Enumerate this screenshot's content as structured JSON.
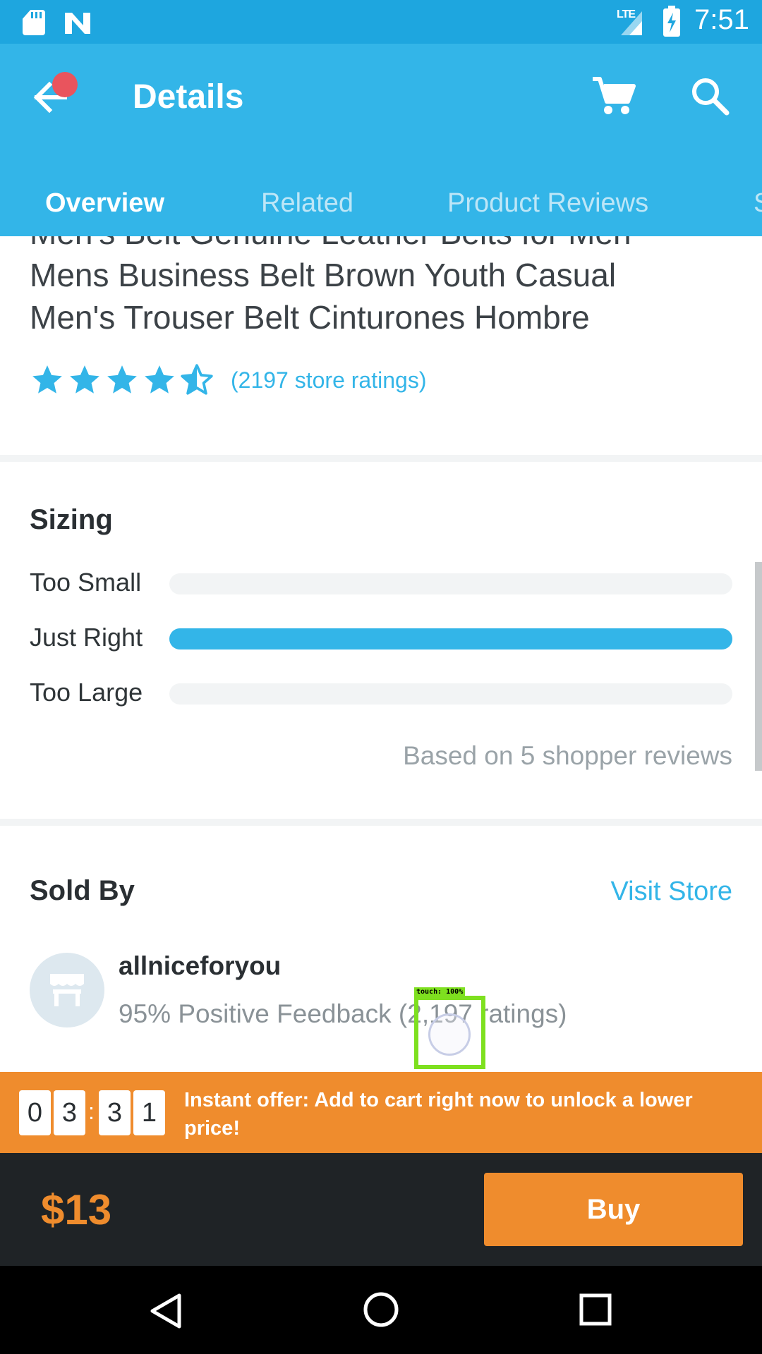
{
  "status_bar": {
    "network_label": "LTE",
    "time": "7:51",
    "icons": [
      "sd-card-icon",
      "n-icon",
      "signal-icon",
      "battery-charging-icon"
    ]
  },
  "header": {
    "title": "Details",
    "icons": [
      "back-arrow-icon",
      "cart-icon",
      "search-icon"
    ],
    "notification_dot_color": "#e9545d",
    "background_color": "#33b5e8"
  },
  "tabs": [
    {
      "label": "Overview",
      "active": true
    },
    {
      "label": "Related",
      "active": false
    },
    {
      "label": "Product Reviews",
      "active": false
    },
    {
      "label": "S",
      "active": false
    }
  ],
  "product": {
    "title": "Men's Belt Genuine Leather Belts for Men Mens Business Belt Brown Youth Casual Men's Trouser Belt Cinturones Hombre",
    "rating_stars": 4.5,
    "store_ratings": "(2197 store ratings)"
  },
  "sizing": {
    "title": "Sizing",
    "rows": [
      {
        "label": "Too Small",
        "fraction": 0
      },
      {
        "label": "Just Right",
        "fraction": 1
      },
      {
        "label": "Too Large",
        "fraction": 0
      }
    ],
    "based_on": "Based on 5 shopper reviews"
  },
  "sold_by": {
    "title": "Sold By",
    "visit_store": "Visit Store",
    "seller_name": "allniceforyou",
    "feedback": "95% Positive Feedback (2,197 ratings)",
    "avatar_icon": "store-icon"
  },
  "touch_overlay": {
    "label": "touch: 100%"
  },
  "offer": {
    "timer_digits": [
      "0",
      "3",
      "3",
      "1"
    ],
    "separator": ":",
    "text": "Instant offer: Add to cart right now to unlock a lower price!",
    "color": "#ef8c2d"
  },
  "buy_bar": {
    "price": "$13",
    "buy_label": "Buy"
  },
  "nav_bar": {
    "icons": [
      "nav-back-icon",
      "nav-home-icon",
      "nav-recents-icon"
    ]
  }
}
